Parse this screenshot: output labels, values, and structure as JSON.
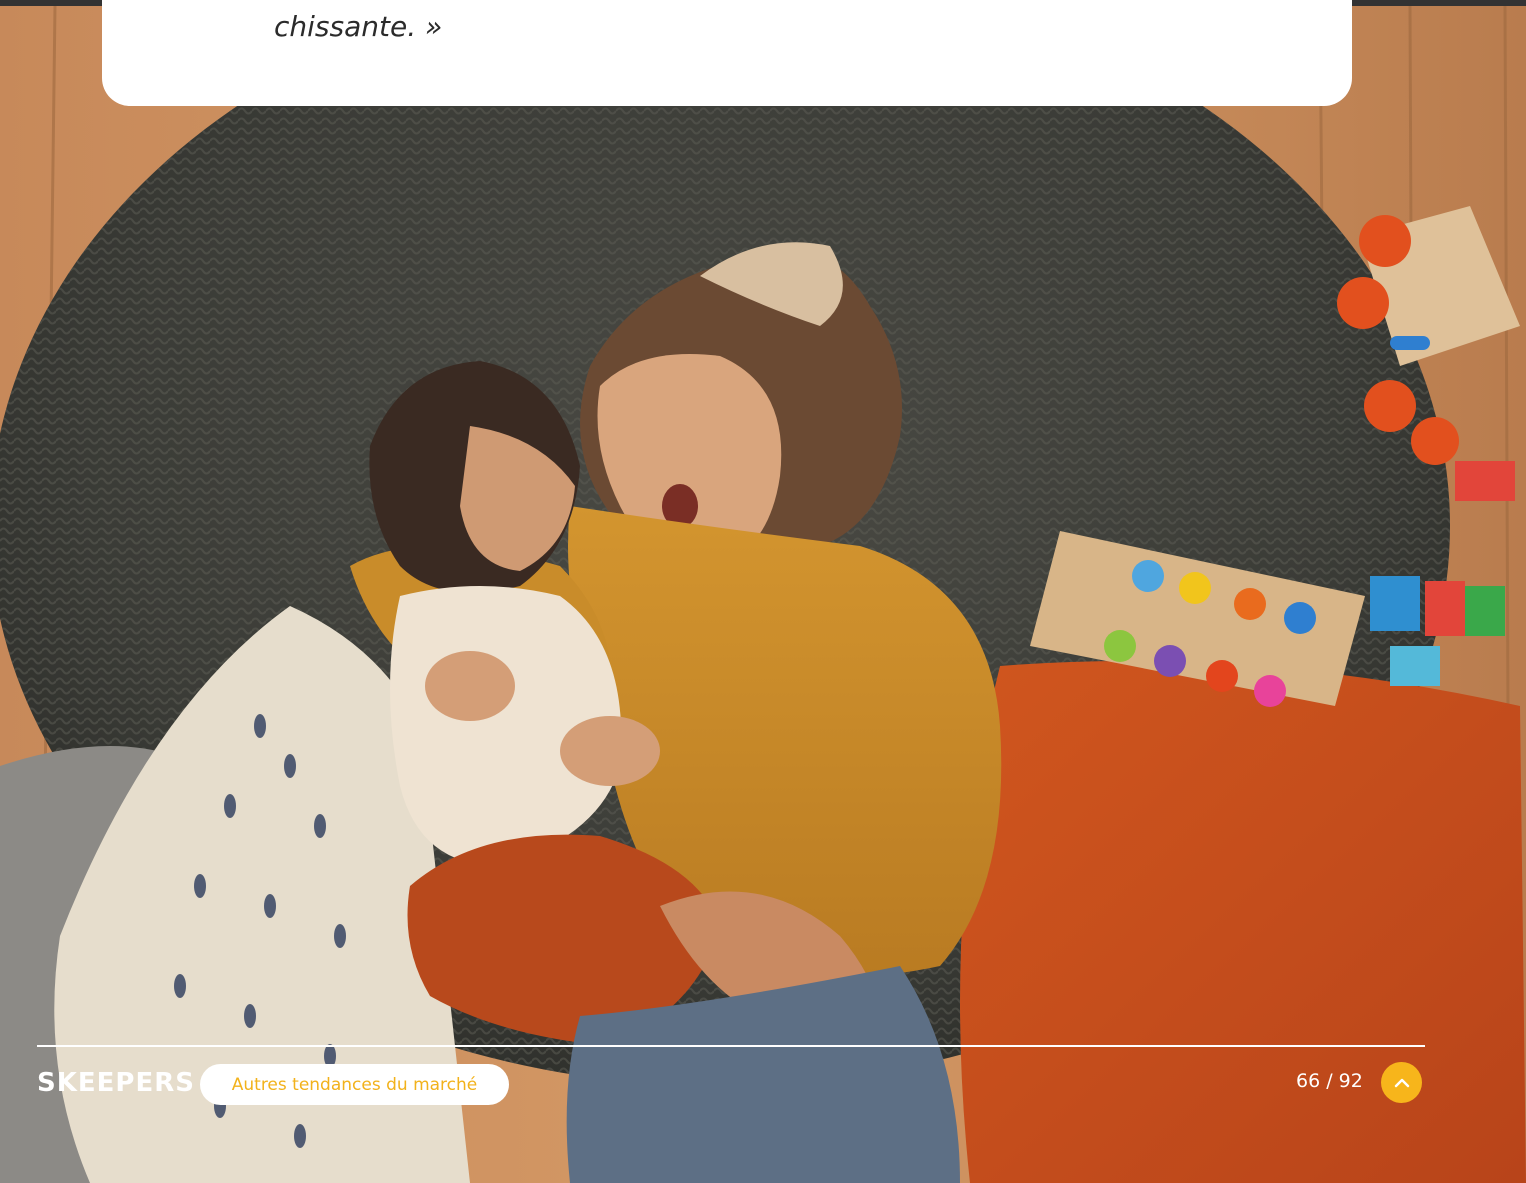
{
  "quote": {
    "text": "chissante. »"
  },
  "footer": {
    "logo_text": "SKEEPERS",
    "section_label": "Autres tendances du marché",
    "page_counter": "66 / 92",
    "back_to_top_icon": "chevron-up-icon"
  },
  "photo": {
    "icon": "photo-image"
  },
  "colors": {
    "accent": "#f7b51b",
    "pill_text": "#f2b21b",
    "card_bg": "#ffffff",
    "text_dark": "#2b2b2b"
  }
}
